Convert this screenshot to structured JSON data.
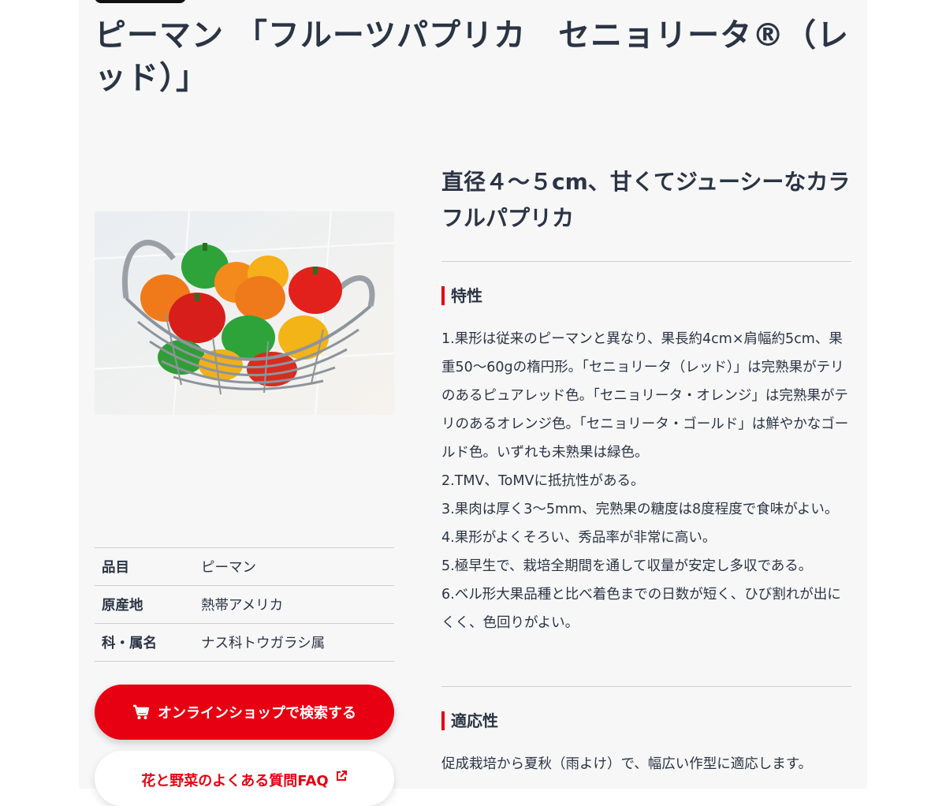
{
  "page": {
    "title": "ピーマン 「フルーツパプリカ　セニョリータ®（レッド）」",
    "tagline": "直径４～５cm、甘くてジューシーなカラフルパプリカ"
  },
  "image": {
    "icon": "pepper-basket-photo"
  },
  "specs": [
    {
      "label": "品目",
      "value": "ピーマン"
    },
    {
      "label": "原産地",
      "value": "熱帯アメリカ"
    },
    {
      "label": "科・属名",
      "value": "ナス科トウガラシ属"
    }
  ],
  "sections": {
    "features_heading": "特性",
    "features": [
      "1.果形は従来のピーマンと異なり、果長約4cm×肩幅約5cm、果重50～60gの楕円形。「セニョリータ（レッド）」は完熟果がテリのあるピュアレッド色。「セニョリータ・オレンジ」は完熟果がテリのあるオレンジ色。「セニョリータ・ゴールド」は鮮やかなゴールド色。いずれも未熟果は緑色。",
      "2.TMV、ToMVに抵抗性がある。",
      "3.果肉は厚く3～5mm、完熟果の糖度は8度程度で食味がよい。",
      "4.果形がよくそろい、秀品率が非常に高い。",
      "5.極早生で、栽培全期間を通して収量が安定し多収である。",
      "6.ベル形大果品種と比べ着色までの日数が短く、ひび割れが出にくく、色回りがよい。"
    ],
    "adapt_heading": "適応性",
    "adapt_text": "促成栽培から夏秋（雨よけ）で、幅広い作型に適応します。"
  },
  "buttons": {
    "shop_label": "オンラインショップで検索する",
    "shop_icon": "cart-icon",
    "faq_label": "花と野菜のよくある質問FAQ",
    "faq_icon": "external-link-icon"
  },
  "colors": {
    "accent": "#e60012",
    "text": "#2b3445",
    "panel": "#f7f7f7"
  }
}
